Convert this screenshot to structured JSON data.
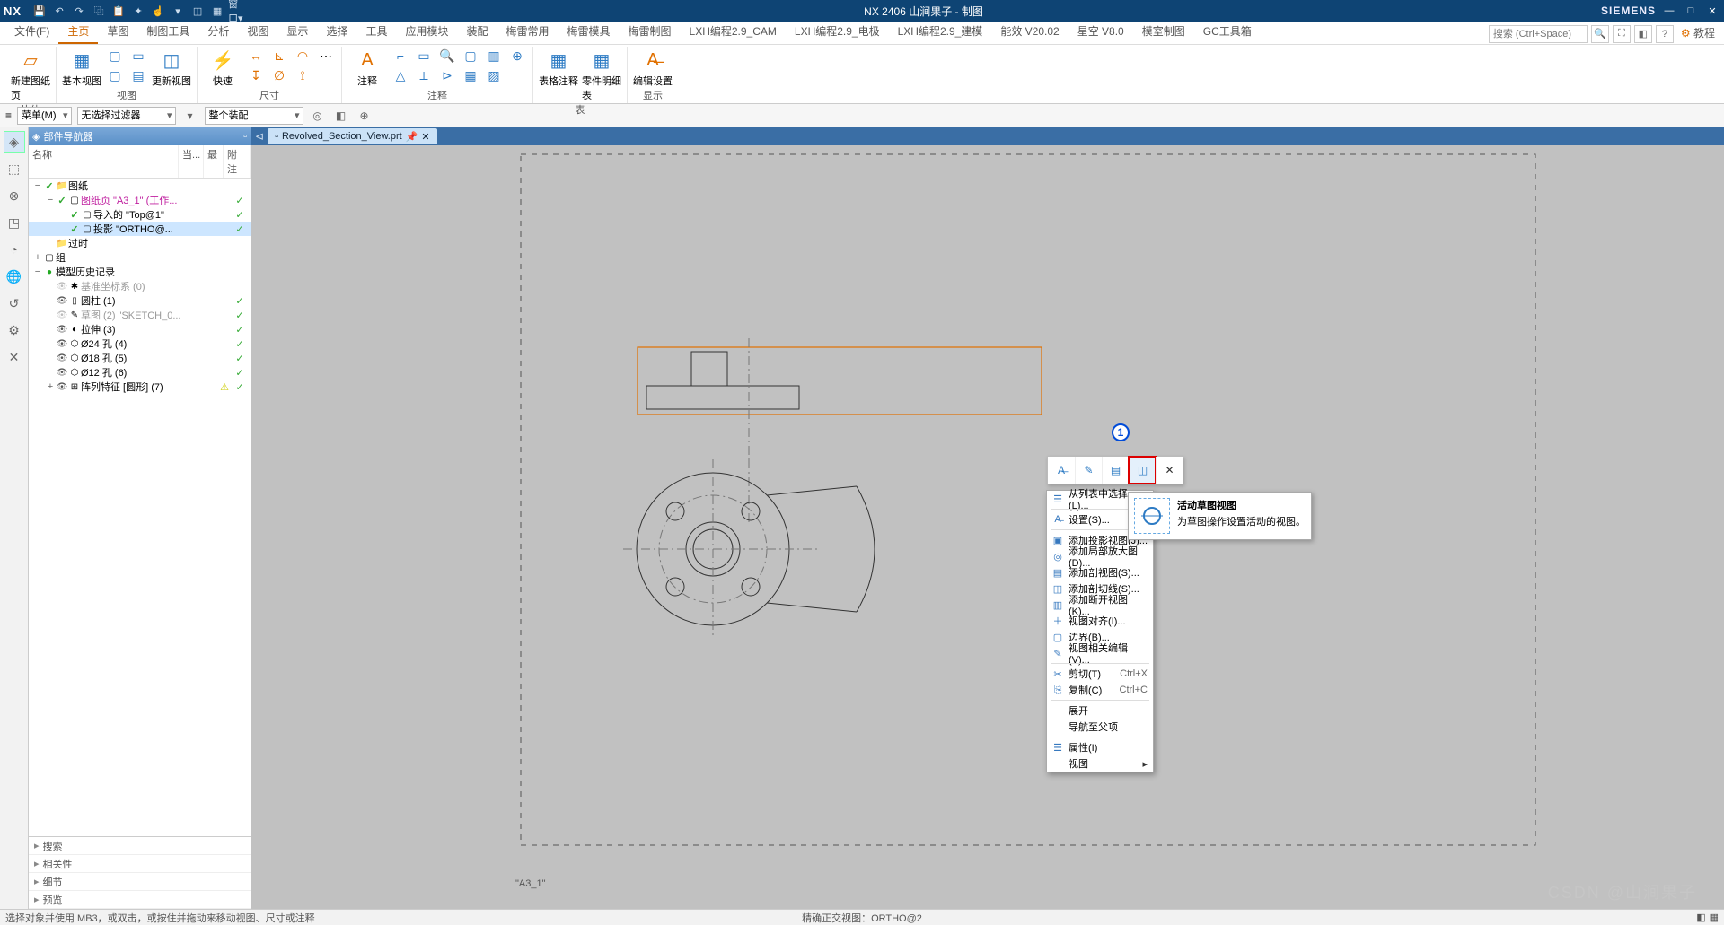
{
  "titlebar": {
    "logo": "NX",
    "title": "NX 2406 山涧果子 - 制图",
    "brand": "SIEMENS"
  },
  "menus": {
    "file": "文件(F)",
    "tabs": [
      "主页",
      "草图",
      "制图工具",
      "分析",
      "视图",
      "显示",
      "选择",
      "工具",
      "应用模块",
      "装配",
      "梅雷常用",
      "梅雷模具",
      "梅雷制图",
      "LXH编程2.9_CAM",
      "LXH编程2.9_电极",
      "LXH编程2.9_建模",
      "能效 V20.02",
      "星空 V8.0",
      "模室制图",
      "GC工具箱"
    ],
    "active_index": 0,
    "search_placeholder": "搜索 (Ctrl+Space)",
    "tutorial": "教程"
  },
  "ribbon": {
    "groups": [
      {
        "label": "片体",
        "big": [
          {
            "icon": "▱",
            "l1": "新建图纸页",
            "cls": "orange"
          }
        ]
      },
      {
        "label": "视图",
        "big": [
          {
            "icon": "▦",
            "l1": "基本视图",
            "cls": "blue"
          }
        ],
        "smalls": [
          "▢",
          "▢",
          "▭",
          "▤"
        ],
        "extra": [
          {
            "icon": "◫",
            "l1": "更新视图",
            "cls": "blue"
          }
        ]
      },
      {
        "label": "尺寸",
        "big": [
          {
            "icon": "⚡",
            "l1": "快速",
            "cls": "orange"
          }
        ],
        "smalls": [
          "↔",
          "↧",
          "⊾",
          "∅",
          "◠",
          "⟟",
          "⋯"
        ]
      },
      {
        "label": "注释",
        "big": [
          {
            "icon": "A",
            "l1": "注释",
            "cls": "orange"
          }
        ],
        "smalls": [
          "⌐",
          "▭",
          "🔍",
          "▢",
          "▥",
          "⊕",
          "△",
          "⟂",
          "⊳",
          "▦",
          "▨"
        ]
      },
      {
        "label": "表",
        "big": [
          {
            "icon": "▦",
            "l1": "表格注释",
            "cls": "blue"
          },
          {
            "icon": "▦",
            "l1": "零件明细表",
            "cls": "blue"
          }
        ]
      },
      {
        "label": "显示",
        "big": [
          {
            "icon": "A̶",
            "l1": "编辑设置",
            "cls": "orange"
          }
        ]
      }
    ]
  },
  "filterbar": {
    "menu": "菜单(M)",
    "filter1": "无选择过滤器",
    "filter2": "整个装配"
  },
  "navigator": {
    "title": "部件导航器",
    "headers": {
      "name": "名称",
      "c1": "当...",
      "c2": "最",
      "c3": "附注"
    },
    "tree": [
      {
        "depth": 0,
        "tw": "−",
        "chk": true,
        "icon": "📁",
        "label": "图纸",
        "col": ""
      },
      {
        "depth": 1,
        "tw": "−",
        "chk": true,
        "icon": "▢",
        "label": "图纸页 \"A3_1\" (工作...",
        "cls": "magenta",
        "col": "✓"
      },
      {
        "depth": 2,
        "tw": "",
        "chk": true,
        "icon": "▢",
        "label": "导入的 \"Top@1\"",
        "col": "✓"
      },
      {
        "depth": 2,
        "tw": "",
        "chk": true,
        "icon": "▢",
        "label": "投影 \"ORTHO@...",
        "sel": true,
        "col": "✓"
      },
      {
        "depth": 1,
        "tw": "",
        "chk": false,
        "icon": "📁",
        "label": "过时",
        "col": ""
      },
      {
        "depth": 0,
        "tw": "+",
        "chk": false,
        "icon": "▢",
        "label": "组",
        "col": ""
      },
      {
        "depth": 0,
        "tw": "−",
        "chk": false,
        "icon": "●",
        "label": "模型历史记录",
        "iconcls": "green",
        "col": ""
      },
      {
        "depth": 1,
        "tw": "",
        "chk": false,
        "icon": "✱",
        "label": "基准坐标系 (0)",
        "cls": "gray",
        "eye": "gray",
        "col": ""
      },
      {
        "depth": 1,
        "tw": "",
        "chk": false,
        "icon": "▯",
        "label": "圆柱 (1)",
        "eye": "on",
        "col": "✓"
      },
      {
        "depth": 1,
        "tw": "",
        "chk": false,
        "icon": "✎",
        "label": "草图 (2) \"SKETCH_0...",
        "cls": "gray",
        "eye": "gray",
        "col": "✓"
      },
      {
        "depth": 1,
        "tw": "",
        "chk": false,
        "icon": "◐",
        "label": "拉伸 (3)",
        "eye": "on",
        "col": "✓"
      },
      {
        "depth": 1,
        "tw": "",
        "chk": false,
        "icon": "⬡",
        "label": "Ø24 孔 (4)",
        "eye": "on",
        "col": "✓"
      },
      {
        "depth": 1,
        "tw": "",
        "chk": false,
        "icon": "⬡",
        "label": "Ø18 孔 (5)",
        "eye": "on",
        "col": "✓"
      },
      {
        "depth": 1,
        "tw": "",
        "chk": false,
        "icon": "⬡",
        "label": "Ø12 孔 (6)",
        "eye": "on",
        "col": "✓"
      },
      {
        "depth": 1,
        "tw": "+",
        "chk": false,
        "icon": "⊞",
        "label": "阵列特征 [圆形] (7)",
        "eye": "on",
        "col": "✓",
        "warn": true
      }
    ],
    "bottom": [
      "搜索",
      "相关性",
      "细节",
      "预览"
    ]
  },
  "document": {
    "tab": "Revolved_Section_View.prt",
    "sheet_label": "\"A3_1\""
  },
  "radial": {
    "items": [
      "A̶",
      "✎",
      "▤",
      "◫",
      "✕"
    ],
    "highlight_index": 3
  },
  "context_menu": {
    "items": [
      {
        "icon": "☰",
        "label": "从列表中选择(L)..."
      },
      {
        "sep": true
      },
      {
        "icon": "A̶",
        "label": "设置(S)..."
      },
      {
        "sep": true
      },
      {
        "icon": "▣",
        "label": "添加投影视图(J)..."
      },
      {
        "icon": "◎",
        "label": "添加局部放大图(D)..."
      },
      {
        "icon": "▤",
        "label": "添加剖视图(S)..."
      },
      {
        "icon": "◫",
        "label": "添加剖切线(S)..."
      },
      {
        "icon": "▥",
        "label": "添加断开视图(K)..."
      },
      {
        "icon": "＋",
        "label": "视图对齐(I)..."
      },
      {
        "icon": "▢",
        "label": "边界(B)..."
      },
      {
        "icon": "✎",
        "label": "视图相关编辑(V)..."
      },
      {
        "sep": true
      },
      {
        "icon": "✂",
        "label": "剪切(T)",
        "sc": "Ctrl+X"
      },
      {
        "icon": "⎘",
        "label": "复制(C)",
        "sc": "Ctrl+C"
      },
      {
        "sep": true
      },
      {
        "label": "展开"
      },
      {
        "label": "导航至父项"
      },
      {
        "sep": true
      },
      {
        "icon": "☰",
        "label": "属性(I)"
      },
      {
        "label": "视图",
        "arrow": true
      }
    ]
  },
  "flyout": {
    "title": "活动草图视图",
    "desc": "为草图操作设置活动的视图。"
  },
  "callout": {
    "num": "1"
  },
  "status": {
    "left": "选择对象并使用 MB3，或双击，或按住并拖动来移动视图、尺寸或注释",
    "center": "精确正交视图：ORTHO@2"
  },
  "watermark": "CSDN @山涧果子"
}
